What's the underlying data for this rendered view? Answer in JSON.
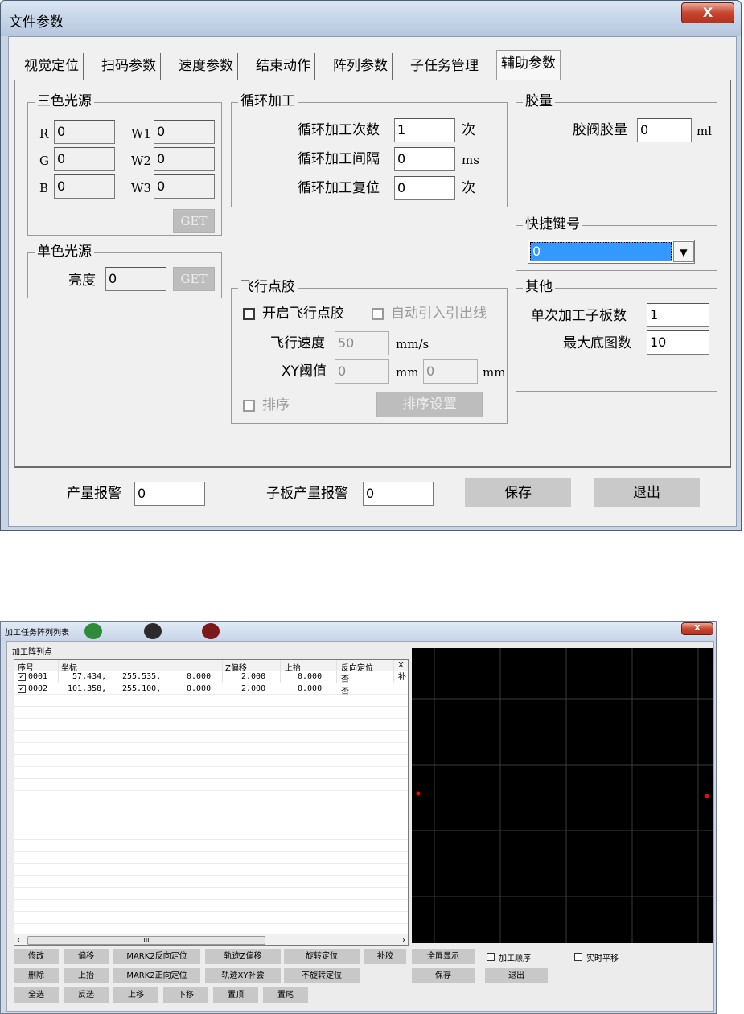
{
  "win1": {
    "title": "文件参数",
    "close": "X",
    "tabs": [
      "视觉定位",
      "扫码参数",
      "速度参数",
      "结束动作",
      "阵列参数",
      "子任务管理",
      "辅助参数"
    ],
    "active_tab": "辅助参数",
    "tri_light": {
      "title": "三色光源",
      "r_label": "R",
      "r": "0",
      "g_label": "G",
      "g": "0",
      "b_label": "B",
      "b": "0",
      "w1_label": "W1",
      "w1": "0",
      "w2_label": "W2",
      "w2": "0",
      "w3_label": "W3",
      "w3": "0",
      "get": "GET"
    },
    "mono_light": {
      "title": "单色光源",
      "brightness_label": "亮度",
      "brightness": "0",
      "get": "GET"
    },
    "loop": {
      "title": "循环加工",
      "count_label": "循环加工次数",
      "count": "1",
      "count_unit": "次",
      "interval_label": "循环加工间隔",
      "interval": "0",
      "interval_unit": "ms",
      "reset_label": "循环加工复位",
      "reset": "0",
      "reset_unit": "次"
    },
    "glue": {
      "title": "胶量",
      "label": "胶阀胶量",
      "value": "0",
      "unit": "ml"
    },
    "hotkey": {
      "title": "快捷键号",
      "value": "0"
    },
    "fly": {
      "title": "飞行点胶",
      "enable": "开启飞行点胶",
      "auto": "自动引入引出线",
      "speed_label": "飞行速度",
      "speed": "50",
      "speed_unit": "mm/s",
      "xy_label": "XY阈值",
      "x": "0",
      "x_unit": "mm",
      "y": "0",
      "y_unit": "mm",
      "sort": "排序",
      "sort_btn": "排序设置"
    },
    "other": {
      "title": "其他",
      "sub_count_label": "单次加工子板数",
      "sub_count": "1",
      "max_img_label": "最大底图数",
      "max_img": "10"
    },
    "bottom": {
      "yield_label": "产量报警",
      "yield": "0",
      "sub_yield_label": "子板产量报警",
      "sub_yield": "0",
      "save": "保存",
      "exit": "退出"
    }
  },
  "win2": {
    "title": "加工任务阵列列表",
    "close": "X",
    "group_title": "加工阵列点",
    "columns": [
      "序号",
      "坐标",
      "Z偏移",
      "上抬",
      "反向定位",
      "X补"
    ],
    "rows": [
      {
        "id": "0001",
        "x": "57.434,",
        "y": "255.535,",
        "z": "0.000",
        "zoff": "2.000",
        "lift": "0.000",
        "rev": "否"
      },
      {
        "id": "0002",
        "x": "101.358,",
        "y": "255.100,",
        "z": "0.000",
        "zoff": "2.000",
        "lift": "0.000",
        "rev": "否"
      }
    ],
    "scroll_thumb": "III",
    "buttons_row1": [
      "修改",
      "偏移",
      "MARK2反向定位",
      "轨迹Z偏移",
      "旋转定位",
      "补胶"
    ],
    "buttons_row2": [
      "删除",
      "上抬",
      "MARK2正向定位",
      "轨迹XY补尝",
      "不旋转定位"
    ],
    "buttons_row3": [
      "全选",
      "反选",
      "上移",
      "下移",
      "置顶",
      "置尾"
    ],
    "right_buttons": {
      "fullscreen": "全屏显示",
      "save": "保存",
      "exit": "退出"
    },
    "checks": {
      "order": "加工顺序",
      "pan": "实时平移"
    },
    "point_color": "#ff0000"
  }
}
